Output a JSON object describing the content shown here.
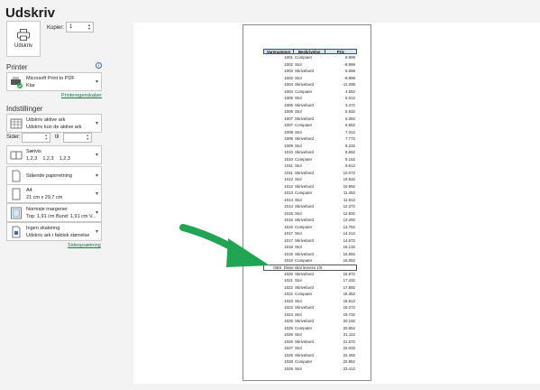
{
  "window": {
    "title": "Udskriv"
  },
  "print": {
    "button_label": "Udskriv",
    "copies_label": "Kopier:",
    "copies_value": "1"
  },
  "printer": {
    "heading": "Printer",
    "name": "Microsoft Print to PDF",
    "status": "Klar",
    "properties_link": "Printeregenskaber"
  },
  "settings": {
    "heading": "Indstillinger",
    "what": {
      "line1": "Udskriv aktive ark",
      "line2": "Udskriv kun de aktive ark"
    },
    "pages_label": "Sider:",
    "to_label": "til",
    "collate": {
      "line1": "Sætvis",
      "line2": "1,2,3    1,2,3    1,2,3"
    },
    "orientation": {
      "line1": "Stående papirretning"
    },
    "paper": {
      "line1": "A4",
      "line2": "21 cm x 29,7 cm"
    },
    "margins": {
      "line1": "Normale margener",
      "line2": "Top: 1,91 cm Bund: 1,91 cm V..."
    },
    "scaling": {
      "line1": "Ingen skalering",
      "line2": "Udskriv ark i faktisk størrelse"
    },
    "page_setup_link": "Sideopsætning"
  },
  "preview": {
    "headers": [
      "Varenummer",
      "Beskrivelse",
      "Pris"
    ],
    "rows_before": [
      [
        "1001",
        "Computer",
        "8.999"
      ],
      [
        "1002",
        "Stol",
        "-8.999"
      ],
      [
        "1003",
        "Skrivebord",
        "5.558"
      ],
      [
        "1002",
        "Stol",
        "-8.999"
      ],
      [
        "1004",
        "Skrivebord",
        "-11.299"
      ],
      [
        "1004",
        "Computer",
        "4.552"
      ],
      [
        "1005",
        "Stol",
        "5.012"
      ],
      [
        "1005",
        "Skrivebord",
        "3.472"
      ],
      [
        "1006",
        "Stol",
        "5.932"
      ],
      [
        "1007",
        "Skrivebord",
        "6.392"
      ],
      [
        "1007",
        "Computer",
        "6.652"
      ],
      [
        "1008",
        "Stol",
        "7.312"
      ],
      [
        "1008",
        "Skrivebord",
        "7.772"
      ],
      [
        "1009",
        "Stol",
        "8.232"
      ],
      [
        "1010",
        "Skrivebord",
        "8.692"
      ],
      [
        "1010",
        "Computer",
        "9.152"
      ],
      [
        "1011",
        "Stol",
        "9.612"
      ],
      [
        "1011",
        "Skrivebord",
        "10.072"
      ],
      [
        "1012",
        "Stol",
        "10.532"
      ],
      [
        "1012",
        "Skrivebord",
        "10.992"
      ],
      [
        "1013",
        "Computer",
        "11.452"
      ],
      [
        "1014",
        "Stol",
        "11.912"
      ],
      [
        "1014",
        "Skrivebord",
        "12.372"
      ],
      [
        "1015",
        "Stol",
        "12.832"
      ],
      [
        "1016",
        "Skrivebord",
        "13.292"
      ],
      [
        "1016",
        "Computer",
        "13.752"
      ],
      [
        "1017",
        "Stol",
        "14.212"
      ],
      [
        "1017",
        "Skrivebord",
        "14.672"
      ],
      [
        "1018",
        "Stol",
        "15.132"
      ],
      [
        "1019",
        "Skrivebord",
        "15.592"
      ],
      [
        "1019",
        "Computer",
        "16.052"
      ]
    ],
    "note": "OBS: Disse skal leveres 1/5",
    "rows_after": [
      [
        "1020",
        "Skrivebord",
        "16.972"
      ],
      [
        "1021",
        "Stol",
        "17.432"
      ],
      [
        "1022",
        "Skrivebord",
        "17.892"
      ],
      [
        "1022",
        "Computer",
        "18.352"
      ],
      [
        "1023",
        "Stol",
        "18.812"
      ],
      [
        "1023",
        "Skrivebord",
        "19.272"
      ],
      [
        "1024",
        "Stol",
        "19.732"
      ],
      [
        "1025",
        "Skrivebord",
        "20.192"
      ],
      [
        "1025",
        "Computer",
        "20.652"
      ],
      [
        "1026",
        "Stol",
        "21.112"
      ],
      [
        "1026",
        "Skrivebord",
        "21.572"
      ],
      [
        "1027",
        "Stol",
        "22.032"
      ],
      [
        "1028",
        "Skrivebord",
        "22.492"
      ],
      [
        "1028",
        "Computer",
        "22.952"
      ],
      [
        "1029",
        "Stol",
        "23.412"
      ]
    ]
  },
  "colors": {
    "accent": "#227447",
    "arrow": "#21a453",
    "header_fill": "#dbe5f1"
  },
  "icons": [
    "printer-icon",
    "pdf-printer-icon",
    "sheet-icon",
    "collate-icon",
    "portrait-icon",
    "paper-icon",
    "margins-icon",
    "scaling-icon",
    "info-icon",
    "chevron-down-icon"
  ]
}
